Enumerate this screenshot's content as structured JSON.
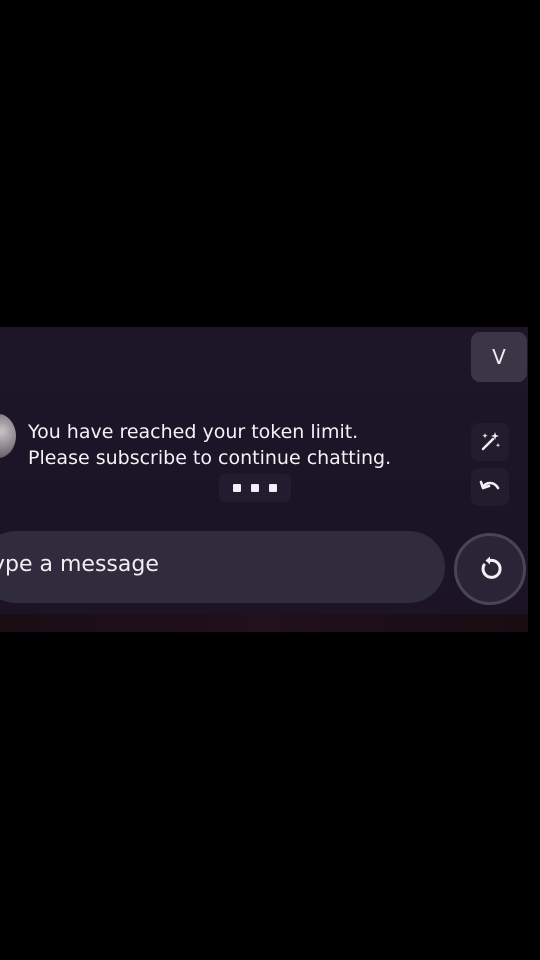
{
  "header": {
    "avatar_button_label": "V"
  },
  "chat": {
    "message_text": "You have reached your token limit.\nPlease subscribe to continue chatting.",
    "typing_indicator_dots": 3
  },
  "side_actions": {
    "icons": [
      "magic-wand-icon",
      "undo-icon"
    ]
  },
  "composer": {
    "placeholder": "Type a message",
    "send_icon": "refresh-icon"
  },
  "colors": {
    "background": "#000000",
    "panel": "#1c1628",
    "input_pill": "#312c3d",
    "text": "#f4f2f7"
  }
}
